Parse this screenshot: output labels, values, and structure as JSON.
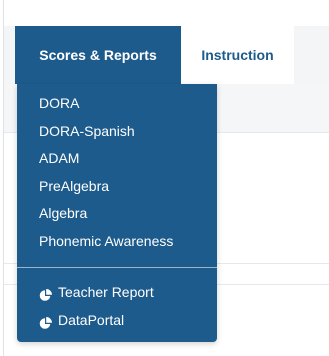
{
  "nav": {
    "tabs": [
      {
        "label": "Scores & Reports",
        "active": true
      },
      {
        "label": "Instruction",
        "active": false
      }
    ]
  },
  "dropdown": {
    "items": [
      {
        "label": "DORA"
      },
      {
        "label": "DORA-Spanish"
      },
      {
        "label": "ADAM"
      },
      {
        "label": "PreAlgebra"
      },
      {
        "label": "Algebra"
      },
      {
        "label": "Phonemic Awareness"
      }
    ],
    "report_items": [
      {
        "label": "Teacher Report",
        "icon": "pie-chart-icon"
      },
      {
        "label": "DataPortal",
        "icon": "pie-chart-icon"
      }
    ]
  },
  "colors": {
    "brand_blue": "#1d5b8c",
    "menu_text": "#ffffff",
    "nav_background": "#f3f5f7"
  }
}
